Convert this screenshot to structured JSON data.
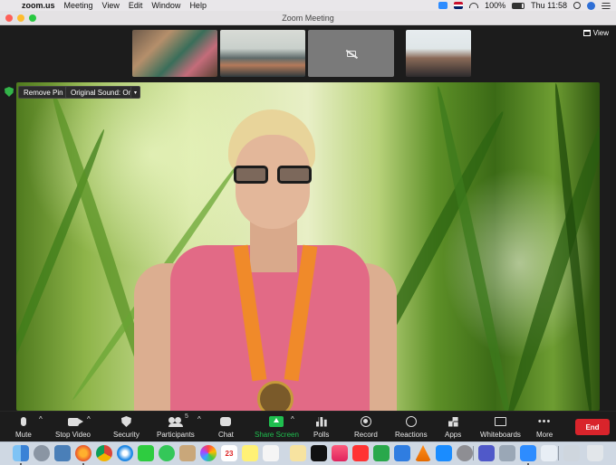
{
  "menubar": {
    "app": "zoom.us",
    "items": [
      "Meeting",
      "View",
      "Edit",
      "Window",
      "Help"
    ],
    "battery": "100%",
    "clock": "Thu 11:58"
  },
  "window": {
    "title": "Zoom Meeting"
  },
  "meeting": {
    "view_label": "View",
    "remove_pin_label": "Remove Pin",
    "original_sound_label": "Original Sound: On",
    "thumbnails": [
      "participant-video-1",
      "participant-video-2",
      "participant-video-off",
      "participant-video-4"
    ]
  },
  "toolbar": {
    "mute": "Mute",
    "stop_video": "Stop Video",
    "security": "Security",
    "participants": "Participants",
    "participants_count": "5",
    "chat": "Chat",
    "share_screen": "Share Screen",
    "polls": "Polls",
    "record": "Record",
    "reactions": "Reactions",
    "apps": "Apps",
    "whiteboards": "Whiteboards",
    "more": "More",
    "end": "End"
  },
  "dock": {
    "calendar_day": "23",
    "apps": [
      "finder",
      "launchpad",
      "preview",
      "firefox",
      "chrome",
      "safari",
      "facetime",
      "messages",
      "contacts",
      "photos",
      "calendar",
      "notes",
      "reminders",
      "tv",
      "music",
      "news",
      "numbers",
      "keynote",
      "vlc",
      "app-store",
      "system-preferences",
      "teams",
      "screenshot",
      "zoom",
      "mail",
      "trash"
    ]
  },
  "colors": {
    "share_green": "#1fbf4f",
    "end_red": "#d9242b",
    "menubar_bg": "#e9e7ea",
    "meeting_bg": "#1c1c1c"
  }
}
